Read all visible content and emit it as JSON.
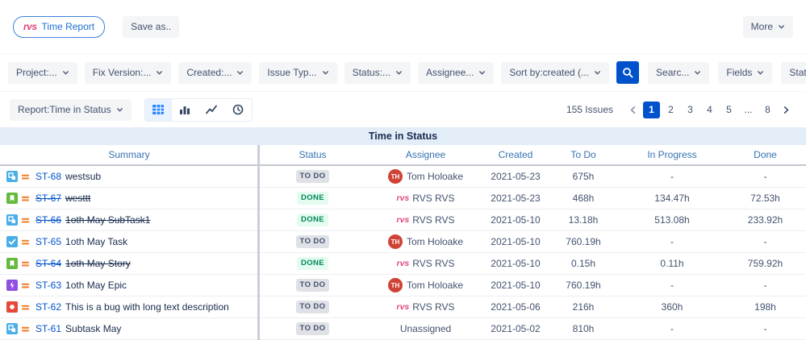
{
  "topbar": {
    "time_report_button": "Time Report",
    "save_as_button": "Save as..",
    "more_button": "More"
  },
  "filter_bar": {
    "dropdowns": [
      {
        "id": "project",
        "label": "Project:..."
      },
      {
        "id": "fix-version",
        "label": "Fix Version:..."
      },
      {
        "id": "created",
        "label": "Created:..."
      },
      {
        "id": "issue-type",
        "label": "Issue Typ..."
      },
      {
        "id": "status",
        "label": "Status:..."
      },
      {
        "id": "assignee",
        "label": "Assignee..."
      },
      {
        "id": "sort-by",
        "label": "Sort by:created (..."
      }
    ],
    "search_button_icon": "search-icon",
    "search_dropdown": "Searc...",
    "fields_dropdown": "Fields",
    "statuses_dropdown": "Statuses"
  },
  "report_bar": {
    "report_dropdown": "Report:Time in Status",
    "view_buttons": [
      "table-view-icon",
      "bar-chart-view-icon",
      "line-chart-view-icon",
      "clock-view-icon"
    ],
    "active_view": "table-view-icon",
    "issues_count": "155 Issues",
    "pagination": {
      "prev_icon": "chevron-left-icon",
      "next_icon": "chevron-right-icon",
      "pages": [
        "1",
        "2",
        "3",
        "4",
        "5",
        "...",
        "8"
      ],
      "active_page": "1"
    }
  },
  "table": {
    "title": "Time in Status",
    "columns": [
      "Summary",
      "Status",
      "Assignee",
      "Created",
      "To Do",
      "In Progress",
      "Done"
    ],
    "rows": [
      {
        "type_icon": "subtask-icon",
        "priority_icon": "priority-medium-icon",
        "key": "ST-68",
        "summary": "westsub",
        "resolved": false,
        "status": "TO DO",
        "status_type": "todo",
        "assignee": "Tom Holoake",
        "avatar": "TH",
        "created": "2021-05-23",
        "to_do": "675h",
        "in_progress": "-",
        "done": "-"
      },
      {
        "type_icon": "story-icon",
        "priority_icon": "priority-medium-icon",
        "key": "ST-67",
        "summary": "westtt",
        "resolved": true,
        "status": "DONE",
        "status_type": "done",
        "assignee": "RVS RVS",
        "avatar": "rvs",
        "created": "2021-05-23",
        "to_do": "468h",
        "in_progress": "134.47h",
        "done": "72.53h"
      },
      {
        "type_icon": "subtask-icon",
        "priority_icon": "priority-medium-icon",
        "key": "ST-66",
        "summary": "1oth May SubTask1",
        "resolved": true,
        "status": "DONE",
        "status_type": "done",
        "assignee": "RVS RVS",
        "avatar": "rvs",
        "created": "2021-05-10",
        "to_do": "13.18h",
        "in_progress": "513.08h",
        "done": "233.92h"
      },
      {
        "type_icon": "task-icon",
        "priority_icon": "priority-medium-icon",
        "key": "ST-65",
        "summary": "1oth May Task",
        "resolved": false,
        "status": "TO DO",
        "status_type": "todo",
        "assignee": "Tom Holoake",
        "avatar": "TH",
        "created": "2021-05-10",
        "to_do": "760.19h",
        "in_progress": "-",
        "done": "-"
      },
      {
        "type_icon": "story-icon",
        "priority_icon": "priority-medium-icon",
        "key": "ST-64",
        "summary": "1oth May Story",
        "resolved": true,
        "status": "DONE",
        "status_type": "done",
        "assignee": "RVS RVS",
        "avatar": "rvs",
        "created": "2021-05-10",
        "to_do": "0.15h",
        "in_progress": "0.11h",
        "done": "759.92h"
      },
      {
        "type_icon": "epic-icon",
        "priority_icon": "priority-medium-icon",
        "key": "ST-63",
        "summary": "1oth May Epic",
        "resolved": false,
        "status": "TO DO",
        "status_type": "todo",
        "assignee": "Tom Holoake",
        "avatar": "TH",
        "created": "2021-05-10",
        "to_do": "760.19h",
        "in_progress": "-",
        "done": "-"
      },
      {
        "type_icon": "bug-icon",
        "priority_icon": "priority-medium-icon",
        "key": "ST-62",
        "summary": "This is a bug with long text description",
        "resolved": false,
        "status": "TO DO",
        "status_type": "todo",
        "assignee": "RVS RVS",
        "avatar": "rvs",
        "created": "2021-05-06",
        "to_do": "216h",
        "in_progress": "360h",
        "done": "198h"
      },
      {
        "type_icon": "subtask-icon",
        "priority_icon": "priority-medium-icon",
        "key": "ST-61",
        "summary": "Subtask May",
        "resolved": false,
        "status": "TO DO",
        "status_type": "todo",
        "assignee": "Unassigned",
        "avatar": null,
        "created": "2021-05-02",
        "to_do": "810h",
        "in_progress": "-",
        "done": "-"
      }
    ]
  },
  "colors": {
    "accent_blue": "#0052CC",
    "header_link_blue": "#3572B0",
    "todo_badge_bg": "#DFE1E6",
    "todo_badge_text": "#42526E",
    "done_badge_bg": "#E3FCEF",
    "done_badge_text": "#00875A",
    "rvs_pink": "#E0457B",
    "avatar_red": "#CF4336"
  }
}
